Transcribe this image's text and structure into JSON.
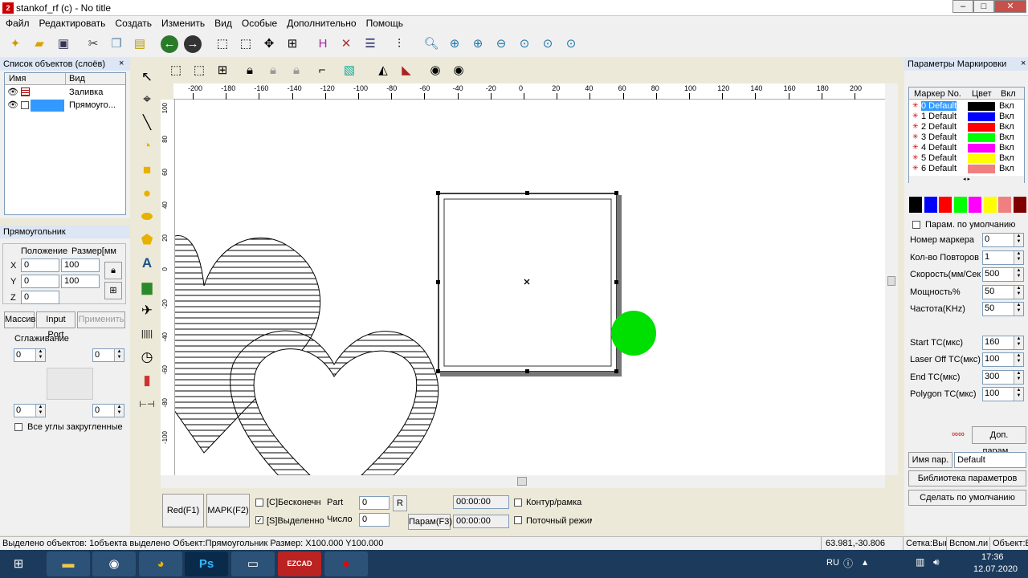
{
  "window": {
    "title": "stankof_rf (c) - No title",
    "icon_label": "2"
  },
  "menu": [
    "Файл",
    "Редактировать",
    "Создать",
    "Изменить",
    "Вид",
    "Особые",
    "Дополнительно",
    "Помощь"
  ],
  "toolbar_icons": [
    "new-file-icon",
    "open-folder-icon",
    "save-icon",
    "cut-icon",
    "copy-icon",
    "paste-icon",
    "back-icon",
    "forward-icon",
    "select-group-icon",
    "select-node-icon",
    "select-move-icon",
    "select-all-icon",
    "hatch-icon",
    "tools-icon",
    "list-icon",
    "align-icon",
    "zoom-icon",
    "zoom-in-icon",
    "zoom-plus-icon",
    "zoom-minus-icon",
    "zoom-fit-icon",
    "zoom-sel-icon",
    "zoom-all-icon"
  ],
  "object_list": {
    "title": "Список объектов (слоёв)",
    "col_name": "Имя",
    "col_type": "Вид",
    "rows": [
      {
        "type": "Заливка"
      },
      {
        "type": "Прямоуго..."
      }
    ]
  },
  "rect_panel": {
    "title": "Прямоугольник",
    "position_label": "Положение",
    "size_label": "Размер[мм",
    "x_label": "X",
    "y_label": "Y",
    "z_label": "Z",
    "x": "0",
    "y": "0",
    "z": "0",
    "w": "100",
    "h": "100",
    "array_btn": "Массив",
    "input_port_btn": "Input Port",
    "apply_btn": "Применить",
    "smoothing_label": "Сглаживание",
    "spin_tl": "0",
    "spin_tr": "0",
    "spin_bl": "0",
    "spin_br": "0",
    "all_rounded_label": "Все углы закругленные"
  },
  "ruler": {
    "h": [
      "-200",
      "-180",
      "-160",
      "-140",
      "-120",
      "-100",
      "-80",
      "-60",
      "-40",
      "-20",
      "0",
      "20",
      "40",
      "60",
      "80",
      "100",
      "120",
      "140",
      "160",
      "180",
      "200"
    ],
    "v": [
      "100",
      "80",
      "60",
      "40",
      "20",
      "0",
      "-20",
      "-40",
      "-60",
      "-80",
      "-100"
    ]
  },
  "bottom": {
    "red_btn": "Red(F1)",
    "mark_btn": "MAPK(F2)",
    "infinite_label": "[C]Бесконечн",
    "selected_label": "[S]Выделенно",
    "part_label": "Part",
    "part_value": "0",
    "r_btn": "R",
    "count_label": "Число",
    "count_value": "0",
    "param_btn": "Парам(F3)",
    "time1": "00:00:00",
    "time2": "00:00:00",
    "contour_label": "Контур/рамка",
    "stream_label": "Поточный режим"
  },
  "marking": {
    "title": "Параметры Маркировки",
    "col_no": "Маркер No.",
    "col_color": "Цвет",
    "col_on": "Вкл",
    "markers": [
      {
        "name": "0 Default",
        "color": "#000000",
        "on": "Вкл"
      },
      {
        "name": "1 Default",
        "color": "#0000ff",
        "on": "Вкл"
      },
      {
        "name": "2 Default",
        "color": "#ff0000",
        "on": "Вкл"
      },
      {
        "name": "3 Default",
        "color": "#00ff00",
        "on": "Вкл"
      },
      {
        "name": "4 Default",
        "color": "#ff00ff",
        "on": "Вкл"
      },
      {
        "name": "5 Default",
        "color": "#ffff00",
        "on": "Вкл"
      },
      {
        "name": "6 Default",
        "color": "#f08080",
        "on": "Вкл"
      }
    ],
    "palette": [
      "#000000",
      "#0000ff",
      "#ff0000",
      "#00ff00",
      "#ff00ff",
      "#ffff00",
      "#f08080",
      "#800000"
    ],
    "default_params_label": "Парам. по умолчанию",
    "params": [
      {
        "label": "Номер маркера",
        "value": "0"
      },
      {
        "label": "Кол-во Повторов",
        "value": "1"
      },
      {
        "label": "Скорость(мм/Сек",
        "value": "500"
      },
      {
        "label": "Мощность%",
        "value": "50"
      },
      {
        "label": "Частота(KHz)",
        "value": "50"
      }
    ],
    "params2": [
      {
        "label": "Start TC(мкс)",
        "value": "160"
      },
      {
        "label": "Laser Off TC(мкс)",
        "value": "100"
      },
      {
        "label": "End TC(мкс)",
        "value": "300"
      },
      {
        "label": "Polygon TC(мкс)",
        "value": "100"
      }
    ],
    "extra_btn": "Доп. парам...",
    "param_name_label": "Имя пар.",
    "param_name_value": "Default",
    "library_btn": "Библиотека параметров",
    "make_default_btn": "Сделать по умолчанию"
  },
  "status": {
    "text": "Выделено объектов: 1объекта выделено Объект:Прямоугольник Размер: X100.000 Y100.000",
    "coords": "63.981,-30.806",
    "grid": "Сетка:Вык",
    "aux": "Вспом.ли",
    "obj": "Объект:В"
  },
  "taskbar": {
    "apps": [
      "windows-start-icon",
      "explorer-icon",
      "media-icon",
      "chrome-icon",
      "photoshop-icon",
      "device-icon",
      "ezcad-icon",
      "record-icon"
    ],
    "lang": "RU",
    "time": "17:36",
    "date": "12.07.2020",
    "ps_label": "Ps",
    "ezcad_label": "EZCAD"
  }
}
